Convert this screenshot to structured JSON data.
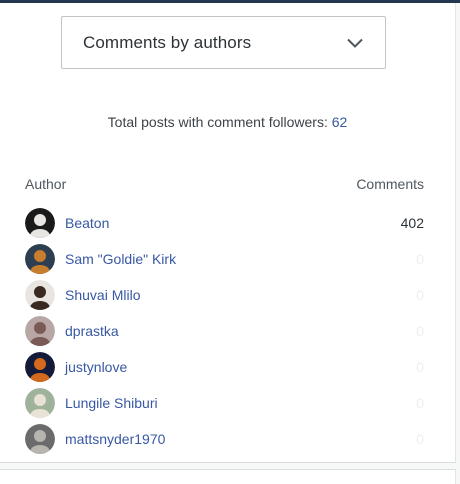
{
  "dropdown": {
    "label": "Comments by authors"
  },
  "summary": {
    "label": "Total posts with comment followers:",
    "count": "62"
  },
  "table": {
    "author_header": "Author",
    "comments_header": "Comments",
    "rows": [
      {
        "name": "Beaton",
        "comments": "402",
        "avatar_colors": [
          "#1a1a1a",
          "#e8e6e3"
        ]
      },
      {
        "name": "Sam \"Goldie\" Kirk",
        "comments": "0",
        "avatar_colors": [
          "#2c3e50",
          "#c77d2e"
        ]
      },
      {
        "name": "Shuvai Mlilo",
        "comments": "0",
        "avatar_colors": [
          "#e9e6e1",
          "#3b2a22"
        ]
      },
      {
        "name": "dprastka",
        "comments": "0",
        "avatar_colors": [
          "#b9a7a5",
          "#7a5a54"
        ]
      },
      {
        "name": "justynlove",
        "comments": "0",
        "avatar_colors": [
          "#141a3a",
          "#d46a1e"
        ]
      },
      {
        "name": "Lungile Shiburi",
        "comments": "0",
        "avatar_colors": [
          "#9fb39a",
          "#e9e2d6"
        ]
      },
      {
        "name": "mattsnyder1970",
        "comments": "0",
        "avatar_colors": [
          "#6b6b6b",
          "#b8b4ae"
        ]
      }
    ]
  },
  "colors": {
    "link": "#3858a3",
    "accent_bar": "#22364f"
  }
}
